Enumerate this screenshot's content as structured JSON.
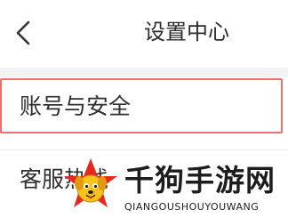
{
  "header": {
    "title": "设置中心",
    "back_icon": "chevron-left-icon"
  },
  "settings": {
    "items": [
      {
        "label": "账号与安全"
      },
      {
        "label": "客服热线"
      }
    ]
  },
  "watermark": {
    "text": "千狗手游网",
    "sub": "QIANGOUSHOUYOUWANG"
  },
  "colors": {
    "highlight_border": "#ef6f6f",
    "watermark_red": "#e8271f",
    "watermark_yellow": "#f7c21b"
  }
}
